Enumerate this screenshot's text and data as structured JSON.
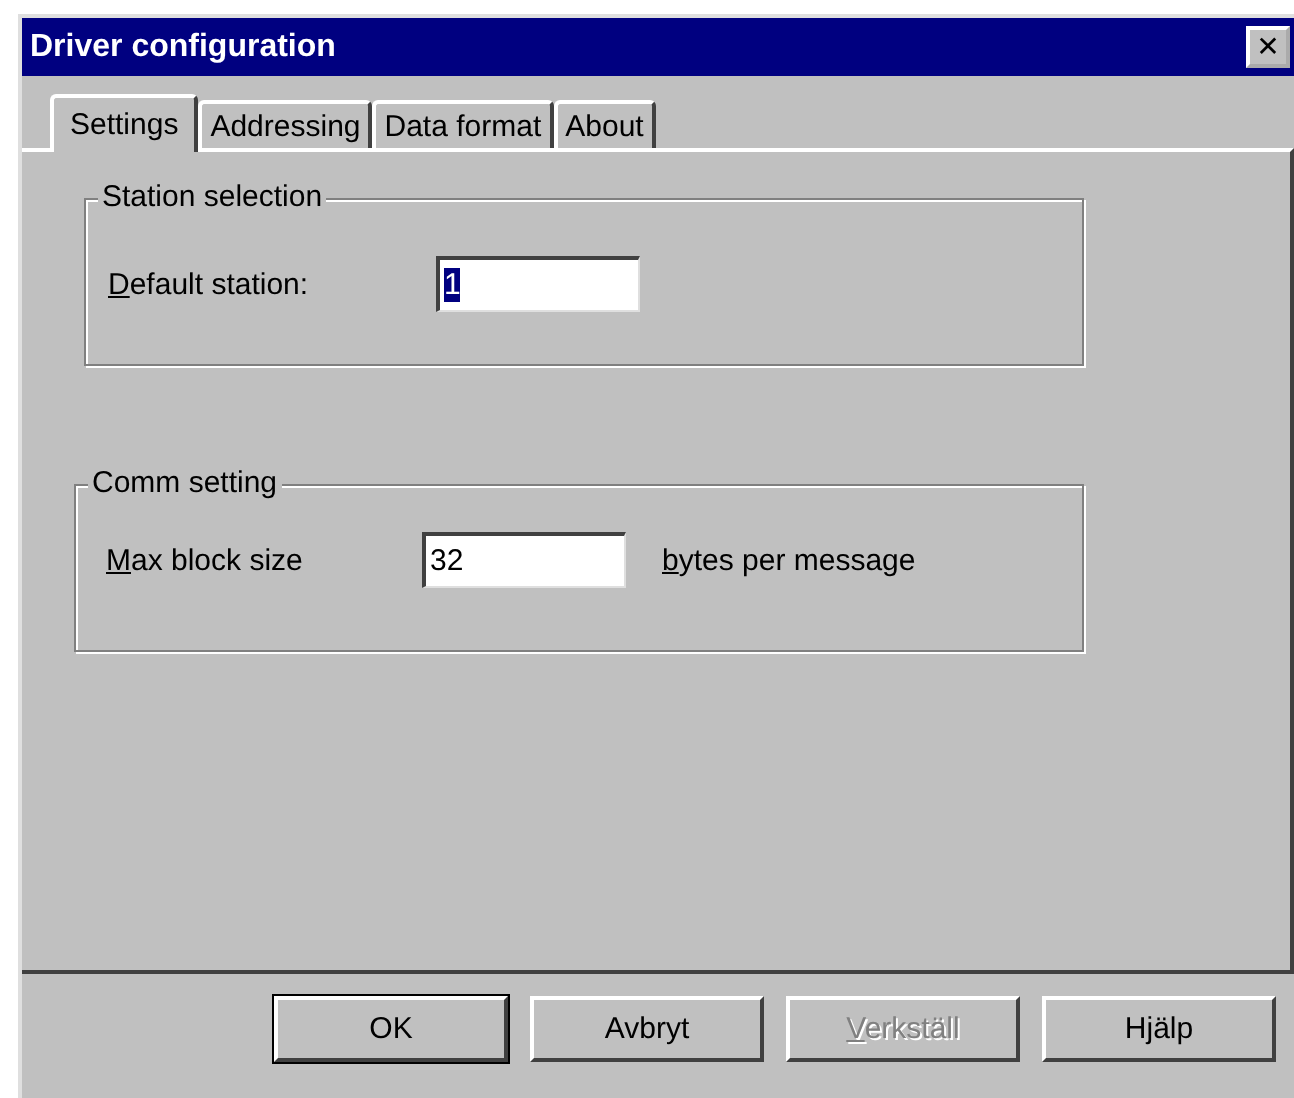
{
  "window": {
    "title": "Driver configuration",
    "close_glyph": "✕"
  },
  "tabs": [
    {
      "label": "Settings",
      "selected": true
    },
    {
      "label": "Addressing",
      "selected": false
    },
    {
      "label": "Data format",
      "selected": false
    },
    {
      "label": "About",
      "selected": false
    }
  ],
  "groups": [
    {
      "title": "Station selection",
      "label": "Default station:",
      "label_underline_first": true,
      "value": "1",
      "value_selected": true
    },
    {
      "title": "Comm setting",
      "label": "Max block size",
      "label_underline_first": true,
      "value": "32",
      "value_selected": false,
      "suffix": "bytes per message",
      "suffix_underline_first": true
    }
  ],
  "buttons": [
    {
      "label": "OK",
      "default": true,
      "disabled": false,
      "underline_first": false
    },
    {
      "label": "Avbryt",
      "default": false,
      "disabled": false,
      "underline_first": false
    },
    {
      "label": "Verkställ",
      "default": false,
      "disabled": true,
      "underline_first": true
    },
    {
      "label": "Hjälp",
      "default": false,
      "disabled": false,
      "underline_first": false
    }
  ]
}
